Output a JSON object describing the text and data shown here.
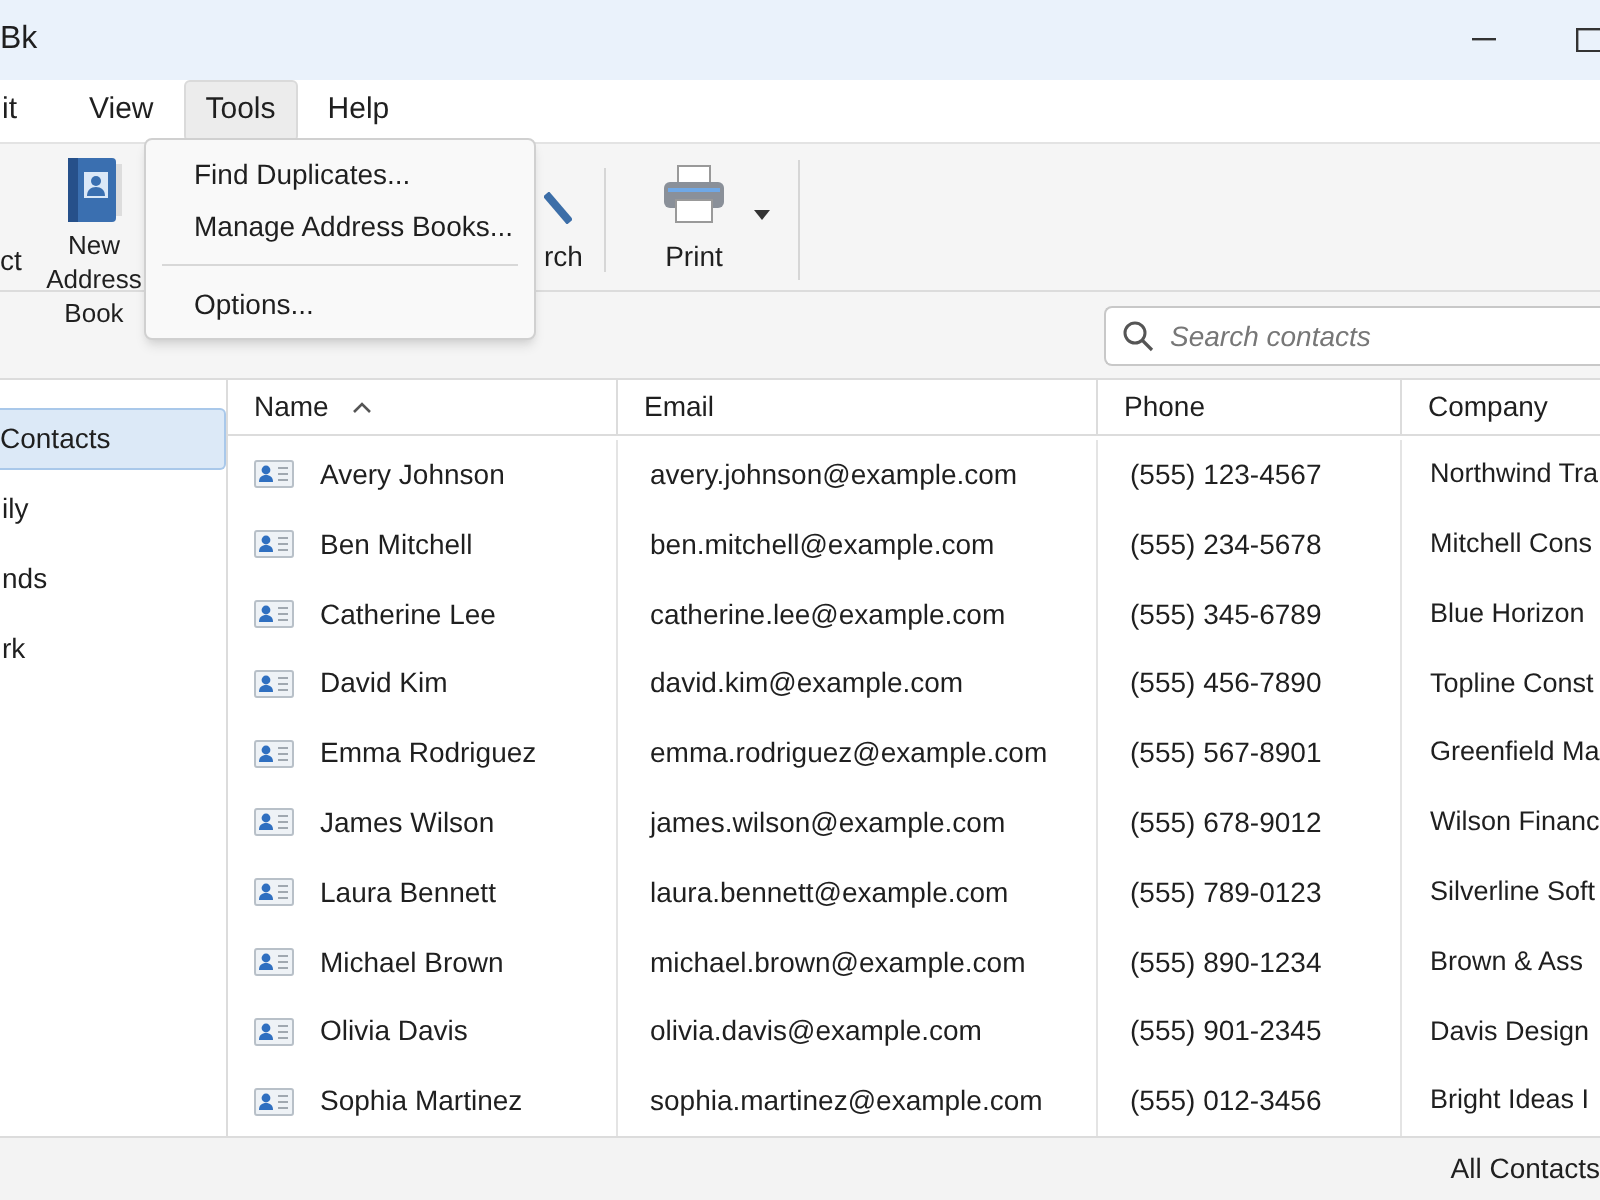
{
  "window": {
    "title": "Bk"
  },
  "menu_bar": [
    {
      "label": "it",
      "selected": false
    },
    {
      "label": "View",
      "selected": false
    },
    {
      "label": "Tools",
      "selected": true
    },
    {
      "label": "Help",
      "selected": false
    }
  ],
  "tools_menu": [
    {
      "kind": "item",
      "label": "Find Duplicates..."
    },
    {
      "kind": "item",
      "label": "Manage Address Books..."
    },
    {
      "kind": "separator"
    },
    {
      "kind": "item",
      "label": "Options..."
    }
  ],
  "toolbar": [
    {
      "kind": "text",
      "label": "ct"
    },
    {
      "kind": "address_book",
      "label": "New Address Book"
    },
    {
      "kind": "search",
      "label": "rch"
    },
    {
      "kind": "print",
      "label": "Print",
      "has_dropdown": true
    }
  ],
  "search": {
    "placeholder": "Search contacts"
  },
  "sidebar": {
    "items": [
      {
        "label": "Contacts",
        "selected": true
      },
      {
        "label": "ily",
        "selected": false
      },
      {
        "label": "nds",
        "selected": false
      },
      {
        "label": "rk",
        "selected": false
      }
    ]
  },
  "table": {
    "columns": [
      {
        "label": "Name",
        "sorted": true
      },
      {
        "label": "Email"
      },
      {
        "label": "Phone"
      },
      {
        "label": "Company"
      }
    ],
    "rows": [
      [
        "Avery Johnson",
        "avery.johnson@example.com",
        "(555) 123-4567",
        "Northwind Tra"
      ],
      [
        "Ben Mitchell",
        "ben.mitchell@example.com",
        "(555) 234-5678",
        "Mitchell Cons"
      ],
      [
        "Catherine Lee",
        "catherine.lee@example.com",
        "(555) 345-6789",
        "Blue Horizon"
      ],
      [
        "David Kim",
        "david.kim@example.com",
        "(555) 456-7890",
        "Topline Const"
      ],
      [
        "Emma Rodriguez",
        "emma.rodriguez@example.com",
        "(555) 567-8901",
        "Greenfield Ma"
      ],
      [
        "James Wilson",
        "james.wilson@example.com",
        "(555) 678-9012",
        "Wilson Financ"
      ],
      [
        "Laura Bennett",
        "laura.bennett@example.com",
        "(555) 789-0123",
        "Silverline Soft"
      ],
      [
        "Michael Brown",
        "michael.brown@example.com",
        "(555) 890-1234",
        "Brown & Ass"
      ],
      [
        "Olivia Davis",
        "olivia.davis@example.com",
        "(555) 901-2345",
        "Davis Design"
      ],
      [
        "Sophia Martinez",
        "sophia.martinez@example.com",
        "(555) 012-3456",
        "Bright Ideas I"
      ]
    ]
  },
  "status_bar": {
    "text": "All Contacts"
  }
}
